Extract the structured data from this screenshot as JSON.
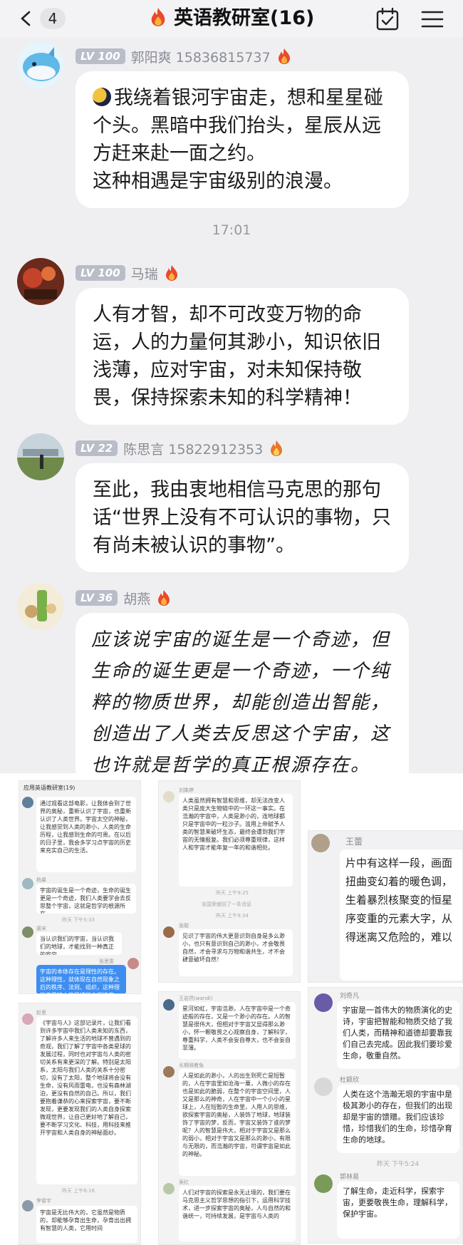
{
  "header": {
    "back_count": "4",
    "title": "英语教研室(16)"
  },
  "messages": [
    {
      "level": "LV 100",
      "name": "郭阳爽 15836815737",
      "text": "我绕着银河宇宙走，想和星星碰个头。黑暗中我们抬头，星辰从远方赶来赴一面之约。\n这种相遇是宇宙级别的浪漫。"
    },
    {
      "level": "LV 100",
      "name": "马瑞",
      "text": "人有才智，却不可改变万物的命运，人的力量何其渺小，知识依旧浅薄，应对宇宙，对未知保持敬畏，保持探索未知的科学精神！"
    },
    {
      "level": "LV 22",
      "name": "陈思言 15822912353",
      "text": "至此，我由衷地相信马克思的那句话“世界上没有不可认识的事物，只有尚未被认识的事物”。"
    },
    {
      "level": "LV 36",
      "name": "胡燕",
      "text": "应该说宇宙的诞生是一个奇迹，但生命的诞生更是一个奇迹，一个纯粹的物质世界，却能创造出智能，创造出了人类去反思这个宇宙，这也许就是哲学的真正根源存在。"
    }
  ],
  "time_separator": "17:01",
  "collage": {
    "shot1": {
      "title": "应用英语教研室(19)",
      "b1": "通过观看这部电影，让我体会到了世界的奥秘，重新认识了宇宙，也重新认识了人类世界。宇宙太空的神秘，让我感觉到人类的渺小，人类的生命历程，让我感到生命的可贵。在以后的日子里，我会多学习点宇宙的历史来充实自己的生活。",
      "n2": "杨果",
      "b2": "宇宙的诞生是一个奇迹，生命的诞生更是一个奇迹，我们人类要学会去反思整个宇宙，这就是哲学的根源所在。",
      "t2": "昨天 下午5:33",
      "n3": "唐宋",
      "b3": "当认识我们的宇宙，当认识我们的地球，才能找到一种真正的安宁。",
      "n4": "张思雯",
      "b4": "宇宙的本体存在是理性的存在。这种理性，就体现在自然现象之后的秩序、法则、组织，这种理性不是被人的思维所主观决定"
    },
    "shot2": {
      "n1": "刘姝婷",
      "b1": "人类虽然拥有智慧和思维，却无法改变人类只是庞大生物链中的一环这一事实。在浩瀚的宇宙中，人类是渺小的，连地球都只是宇宙中的一粒沙子。滥用上帝赋予人类的智慧来破坏生态，最终会遭到我们宇宙的无情报复。我们必须尊重规律，这样人和宇宙才能年复一年的和谐相处。",
      "t1": "昨天 上午9:25",
      "sys": "张国荣撤回了一条消息",
      "t2": "昨天 上午9:34",
      "n3": "张聪",
      "b3": "见识了宇宙的伟大更意识到自身是多么渺小，也只有意识到自己的渺小，才会敬畏自然，才会寻求与万物和谐共生，才不会肆意破坏自然！"
    },
    "shot3": {
      "name": "王蕾",
      "text": "片中有这样一段，画面扭曲变幻着的暖色调，生着暴烈核聚变的恒星序变重的元素大字，从得迷离又危险的，难以"
    },
    "shot4": {
      "n1": "刘奇凡",
      "b1": "宇宙是一首伟大的物质演化的史诗，宇宙把智能和物质交给了我们人类，而精神和道德却要靠我们自己去完成。因此我们要珍爱生命，敬重自然。",
      "n2": "杜颖欣",
      "b2": "人类在这个浩瀚无垠的宇宙中是极其渺小的存在，但我们的出现却是宇宙的馈赠。我们应该珍惜，珍惜我们的生命，珍惜孕育生命的地球。",
      "t2": "昨天 下午5:24",
      "n3": "郭林易",
      "b3": "了解生命，走近科学，探索宇宙，更要敬畏生命，理解科学，保护宇宙。"
    },
    "shot5": {
      "n1": "赵思",
      "b1": "《宇宙与人》这部记录片，让我们看到许多宇宙中我们人类未知的东西，了解许多人来生活的地球不曾遇到的奇观，我们了解了宇宙中各类星球的发展过程，同时也对宇宙与人类的密切关系有来更深的了解。特别是太阳系，太阳与我们人类的关系十分密切，没有了太阳，整个地球将会没有生命，没有风雨雷电，也没有森林湖泊，更没有自然的自己。所以，我们要抱着谦恭的心来探索宇宙，要不断发现，更要发现我们的人类自身探索微观世界，让自己更好地了解自己，要不断学习文化、科技，用科技来推开宇宙和人类自身的神秘面纱。",
      "t1": "昨天 上午6:16",
      "n2": "李俊宇",
      "b2": "宇宙是无比伟大的，它虽然是物质的，却能够孕育出生命，孕育出出拥有智慧的人类，它用时间"
    },
    "shot6": {
      "n1": "王岩然(wandi)",
      "b1": "星河如虹，宇宙浩渺。人在宇宙中是一个奇迹般的存在，又是一个渺小的存在。人的智慧是很伟大，但相对于宇宙又显得那么渺小，怀一颗敬畏之心观察自身，了解科学，尊重科学，人类不会妄自尊大，也不会妄自菲薄。",
      "n2": "长期骑着兔",
      "b2": "人是如此的渺小，人的出生到死亡是短暂的，人在宇宙里如沧海一粟，人微小的存在也是如此的脆弱，在整个的宇宙空间里，人又是那么的神奇，人在宇宙中一个小小的星球上，人在短暂的生命里，人用人的思维，欲探索宇宙的奥秘，人装饰了地球，地球装饰了宇宙的梦，反而，宇宙又装饰了谁的梦呢？人的智慧是伟大，相对于宇宙又是那么的弱小，相对于宇宙又是那么的渺小，有限与无限的，而浩瀚的宇宙，可谓宇宙是如此的神秘。",
      "n3": "吴红",
      "b3": "人们对宇宙的探索是永无止境的，我们要在马克思主义哲学思想的指引下，运用科学技术，进一步探索宇宙的奥秘，人与自然的和谐统一，可持续发展，是宇宙与人类的"
    }
  }
}
